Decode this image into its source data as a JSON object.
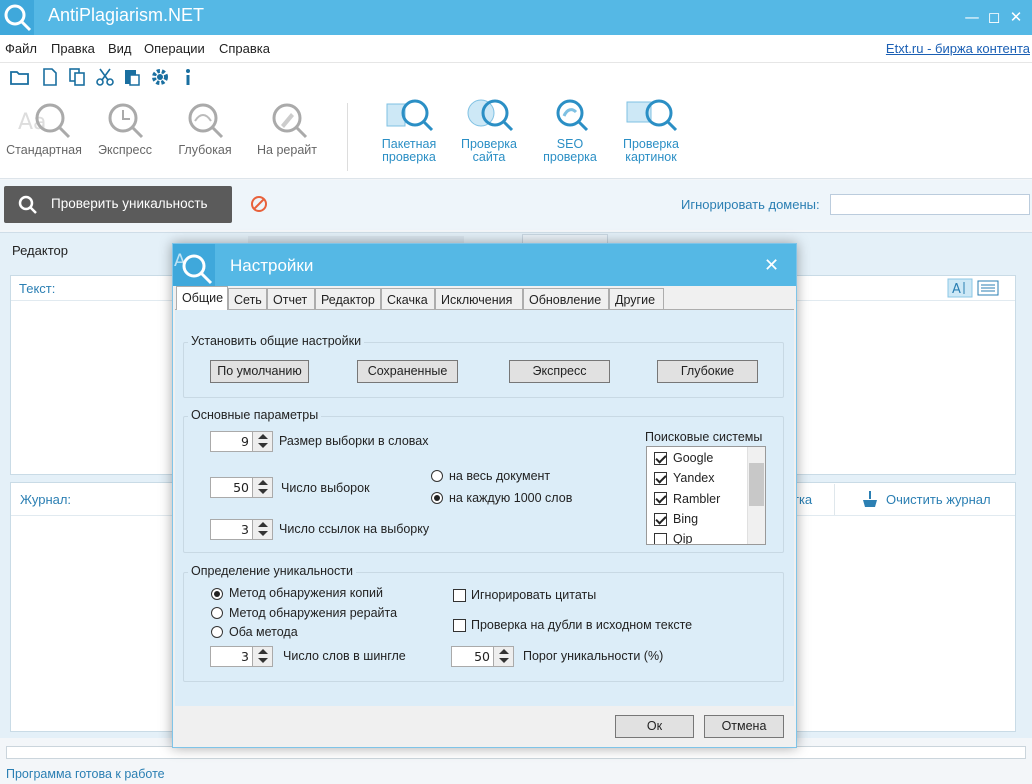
{
  "app": {
    "title": "AntiPlagiarism.NET"
  },
  "menu": [
    "Файл",
    "Правка",
    "Вид",
    "Операции",
    "Справка"
  ],
  "etxt_link": "Etxt.ru - биржа контента",
  "toolbar_icons": [
    "open-folder-icon",
    "new-doc-icon",
    "copy-icon",
    "cut-icon",
    "paste-icon",
    "settings-icon",
    "info-icon"
  ],
  "ribbon": {
    "check_types": [
      "Стандартная",
      "Экспресс",
      "Глубокая",
      "На рерайт"
    ],
    "batch": [
      "Пакетная",
      "проверка"
    ],
    "site": [
      "Проверка",
      "сайта"
    ],
    "seo": [
      "SEO",
      "проверка"
    ],
    "images": [
      "Проверка",
      "картинок"
    ]
  },
  "checkbar": {
    "check_button": "Проверить уникальность",
    "ignore_domains_label": "Игнорировать домены:",
    "ignore_domains_value": ""
  },
  "editor": {
    "tab": "Редактор",
    "text_label": "Текст:",
    "journal_label": "Журнал:",
    "journal_partial": "тка",
    "clear_journal": "Очистить журнал"
  },
  "status": "Программа готова к работе",
  "dialog": {
    "title": "Настройки",
    "tabs": [
      "Общие",
      "Сеть",
      "Отчет",
      "Редактор",
      "Скачка",
      "Исключения",
      "Обновление",
      "Другие"
    ],
    "active_tab": "Общие",
    "general": {
      "title": "Установить общие настройки",
      "buttons": [
        "По умолчанию",
        "Сохраненные",
        "Экспресс",
        "Глубокие"
      ]
    },
    "basic": {
      "title": "Основные параметры",
      "sample_size": {
        "value": "9",
        "label": "Размер выборки в словах"
      },
      "sample_count": {
        "value": "50",
        "label": "Число выборок"
      },
      "links_per_sample": {
        "value": "3",
        "label": "Число ссылок на выборку"
      },
      "scope_options": [
        {
          "label": "на весь документ",
          "checked": false
        },
        {
          "label": "на каждую 1000 слов",
          "checked": true
        }
      ],
      "engines_title": "Поисковые системы",
      "engines": [
        {
          "label": "Google",
          "checked": true
        },
        {
          "label": "Yandex",
          "checked": true
        },
        {
          "label": "Rambler",
          "checked": true
        },
        {
          "label": "Bing",
          "checked": true
        },
        {
          "label": "Qip",
          "checked": false
        }
      ]
    },
    "uniqueness": {
      "title": "Определение уникальности",
      "methods": [
        {
          "label": "Метод обнаружения копий",
          "checked": true
        },
        {
          "label": "Метод обнаружения рерайта",
          "checked": false
        },
        {
          "label": "Оба метода",
          "checked": false
        }
      ],
      "ignore_quotes": {
        "label": "Игнорировать цитаты",
        "checked": false
      },
      "check_duplicates": {
        "label": "Проверка на дубли в исходном тексте",
        "checked": false
      },
      "shingle": {
        "value": "3",
        "label": "Число слов в шингле"
      },
      "threshold": {
        "value": "50",
        "label": "Порог уникальности (%)"
      }
    },
    "ok": "Ок",
    "cancel": "Отмена"
  }
}
